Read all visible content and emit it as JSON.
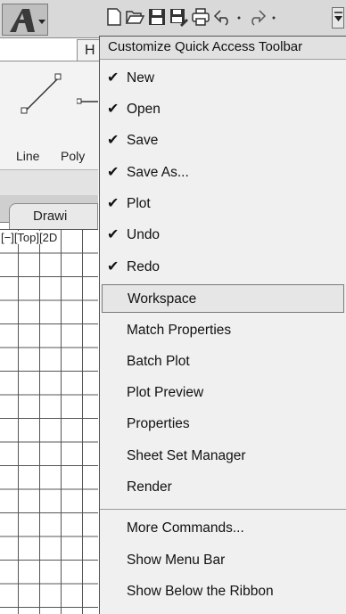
{
  "ribbon": {
    "home_tab": "H",
    "line_tool": "Line",
    "polyline_tool": "Poly"
  },
  "document": {
    "tab_label": "Drawi",
    "viewport_label": "[−][Top][2D"
  },
  "qat": {
    "icons": [
      "new-icon",
      "open-icon",
      "save-icon",
      "save-as-icon",
      "plot-icon",
      "undo-icon",
      "redo-icon"
    ]
  },
  "menu": {
    "header": "Customize Quick Access Toolbar",
    "checked_items": [
      {
        "label": "New",
        "checked": true
      },
      {
        "label": "Open",
        "checked": true
      },
      {
        "label": "Save",
        "checked": true
      },
      {
        "label": "Save As...",
        "checked": true
      },
      {
        "label": "Plot",
        "checked": true
      },
      {
        "label": "Undo",
        "checked": true
      },
      {
        "label": "Redo",
        "checked": true
      }
    ],
    "unchecked_items": [
      {
        "label": "Workspace",
        "highlighted": true
      },
      {
        "label": "Match Properties"
      },
      {
        "label": "Batch Plot"
      },
      {
        "label": "Plot Preview"
      },
      {
        "label": "Properties"
      },
      {
        "label": "Sheet Set Manager"
      },
      {
        "label": "Render"
      }
    ],
    "bottom_items": [
      {
        "label": "More Commands..."
      },
      {
        "label": "Show Menu Bar"
      },
      {
        "label": "Show Below the Ribbon"
      }
    ],
    "check_glyph": "✔"
  }
}
